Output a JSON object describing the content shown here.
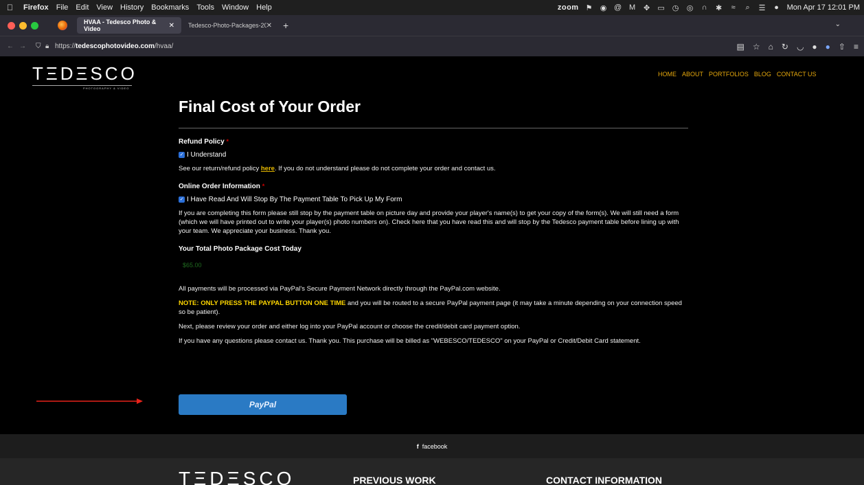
{
  "menubar": {
    "apple": "",
    "items": [
      "Firefox",
      "File",
      "Edit",
      "View",
      "History",
      "Bookmarks",
      "Tools",
      "Window",
      "Help"
    ],
    "zoom": "zoom",
    "datetime": "Mon Apr 17  12:01 PM"
  },
  "tabs": [
    {
      "title": "HVAA - Tedesco Photo & Video",
      "close": "✕"
    },
    {
      "title": "Tedesco-Photo-Packages-2023-HV",
      "close": "✕"
    }
  ],
  "newtab": "+",
  "tabmenu": "⌄",
  "navbar": {
    "back": "←",
    "forward": "→",
    "url_prefix": "https://",
    "url_host": "tedescophotovideo.com",
    "url_path": "/hvaa/"
  },
  "site": {
    "logo": "TΞDΞSCO",
    "logo_tag": "PHOTOGRAPHY & VIDEO",
    "nav": [
      "HOME",
      "ABOUT",
      "PORTFOLIOS",
      "BLOG",
      "CONTACT US"
    ]
  },
  "content": {
    "title": "Final Cost of Your Order",
    "refund_heading": "Refund Policy",
    "required_mark": "*",
    "understand_label": "I Understand",
    "refund_text_1": "See our return/refund policy ",
    "refund_link": "here",
    "refund_text_2": ". If you do not understand please do not complete your order and contact us.",
    "online_heading": "Online Order Information",
    "online_check_label": "I Have Read And Will Stop By The Payment Table To Pick Up My Form",
    "online_text": "If you are completing this form please still stop by the payment table on picture day and provide your player's name(s) to get your copy of the form(s). We will still need a form (which we will have printed out to write your player(s) photo numbers on). Check here that you have read this and will stop by the Tedesco payment table before lining up with your team. We appreciate your business. Thank you.",
    "total_heading": "Your Total Photo Package Cost Today",
    "total_price": "$65.00",
    "paypal_text": "All payments will be processed via PayPal's Secure Payment Network directly through the PayPal.com website.",
    "note_bold": "NOTE: ONLY PRESS THE PAYPAL BUTTON ONE TIME",
    "note_rest": " and you will be routed to a secure PayPal payment page (it may take a minute depending on your connection speed so be patient).",
    "next_text": "Next, please review your order and either log into your PayPal account or choose the credit/debit card payment option.",
    "questions_text": "If you have any questions please contact us. Thank you. This purchase will be billed as \"WEBESCO/TEDESCO\" on your PayPal or Credit/Debit Card statement.",
    "paypal_button": "PayPal"
  },
  "footer": {
    "facebook_icon": "f",
    "facebook": "facebook",
    "logo": "TΞDΞSCO",
    "previous_work": "PREVIOUS WORK",
    "contact_info": "CONTACT INFORMATION"
  },
  "colors": {
    "accent_nav": "#e6a80c",
    "paypal_button": "#2a7ac4",
    "note": "#ffd700",
    "price": "#1f6b1f",
    "arrow": "#e8231a"
  }
}
